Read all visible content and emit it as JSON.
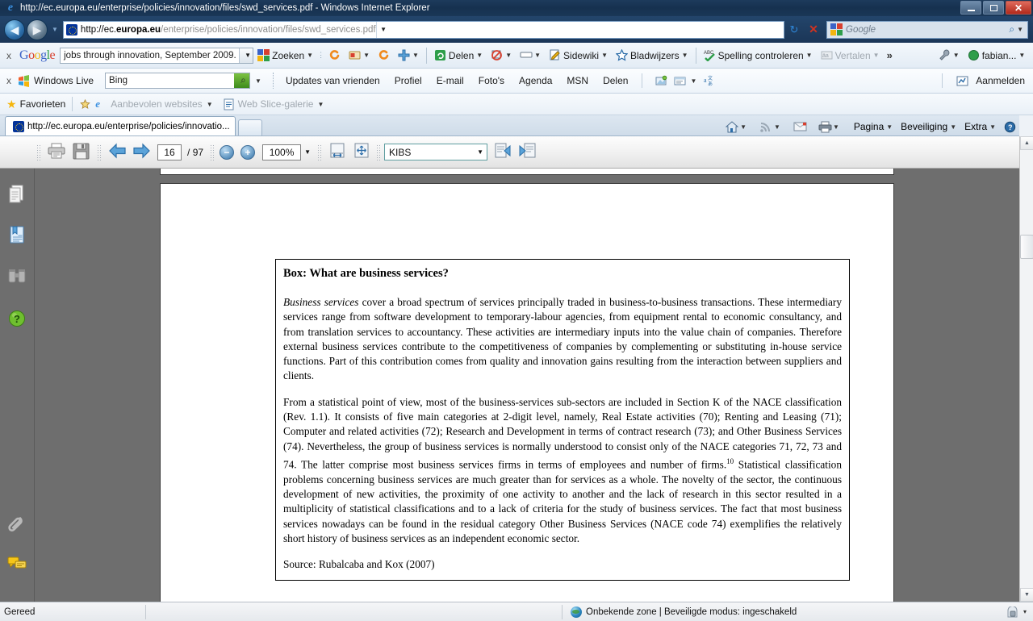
{
  "window": {
    "title": "http://ec.europa.eu/enterprise/policies/innovation/files/swd_services.pdf - Windows Internet Explorer",
    "app_icon": "ie-logo-icon",
    "minimize": "–",
    "maximize": "❐",
    "close": "✕"
  },
  "address_bar": {
    "back_icon": "◀",
    "forward_icon": "▶",
    "history_caret": "▾",
    "site_icon": "eu-flag-icon",
    "url_prefix": "http://ec.",
    "url_domain": "europa.eu",
    "url_path": "/enterprise/policies/innovation/files/swd_services.pdf",
    "dropdown_caret": "▾",
    "refresh_icon": "↻",
    "stop_icon": "✕",
    "search_placeholder": "Google",
    "search_value": "",
    "search_icon": "⚲",
    "search_caret": "▾"
  },
  "google_toolbar": {
    "close_label": "x",
    "logo": [
      {
        "t": "G",
        "c": "b"
      },
      {
        "t": "o",
        "c": "r"
      },
      {
        "t": "o",
        "c": "y"
      },
      {
        "t": "g",
        "c": "b"
      },
      {
        "t": "l",
        "c": "g"
      },
      {
        "t": "e",
        "c": "r"
      }
    ],
    "query": "jobs through innovation, September 2009.",
    "input_caret": "▾",
    "buttons": [
      {
        "label": "Zoeken",
        "icon": "google-multicolor-icon",
        "caret": "▾"
      },
      {
        "label": "",
        "icon": "swirl-icon",
        "caret": ""
      },
      {
        "label": "",
        "icon": "bookmark-card-icon",
        "caret": "▾"
      },
      {
        "label": "",
        "icon": "swirl-icon",
        "caret": ""
      },
      {
        "label": "",
        "icon": "plus-icon",
        "caret": "▾"
      },
      {
        "label": "Delen",
        "icon": "share-icon",
        "caret": "▾"
      },
      {
        "label": "",
        "icon": "popup-blocker-icon",
        "caret": "▾"
      },
      {
        "label": "",
        "icon": "form-fill-icon",
        "caret": "▾"
      },
      {
        "label": "Sidewiki",
        "icon": "sidewiki-icon",
        "caret": "▾"
      },
      {
        "label": "Bladwijzers",
        "icon": "star-icon",
        "caret": "▾"
      },
      {
        "label": "Spelling controleren",
        "icon": "abc-check-icon",
        "caret": "▾"
      },
      {
        "label": "Vertalen",
        "icon": "translate-icon",
        "caret": "▾",
        "disabled": true
      }
    ],
    "overflow": "»",
    "wrench_icon": "wrench-icon",
    "wrench_caret": "▾",
    "account": "fabian...",
    "account_caret": "▾"
  },
  "windows_live_toolbar": {
    "close_label": "x",
    "brand": "Windows Live",
    "search_value": "Bing",
    "search_button_icon": "⚲",
    "search_caret": "▾",
    "links": [
      "Updates van vrienden",
      "Profiel",
      "E-mail",
      "Foto's",
      "Agenda",
      "MSN",
      "Delen"
    ],
    "tool_icons": [
      "map-pin-icon",
      "toolbar-window-icon",
      "translate-a-icon"
    ],
    "right_icon": "signin-icon",
    "right_label": "Aanmelden"
  },
  "favorites_bar": {
    "star_icon": "★",
    "favorites_label": "Favorieten",
    "suggested_icon": "suggested-sites-icon",
    "suggested_label": "Aanbevolen websites",
    "suggested_caret": "▾",
    "webslice_icon": "web-slice-icon",
    "webslice_label": "Web Slice-galerie",
    "webslice_caret": "▾"
  },
  "tab_bar": {
    "tab_icon": "eu-flag-icon",
    "tab_title": "http://ec.europa.eu/enterprise/policies/innovatio...",
    "new_tab_label": "",
    "right_items": [
      {
        "icon": "home-icon",
        "label": "",
        "caret": "▾"
      },
      {
        "icon": "feeds-icon",
        "label": "",
        "caret": "▾"
      },
      {
        "icon": "mail-icon",
        "label": "",
        "caret": ""
      },
      {
        "icon": "print-icon",
        "label": "",
        "caret": "▾"
      },
      {
        "icon": "",
        "label": "Pagina",
        "caret": "▾"
      },
      {
        "icon": "",
        "label": "Beveiliging",
        "caret": "▾"
      },
      {
        "icon": "",
        "label": "Extra",
        "caret": "▾"
      },
      {
        "icon": "help-icon",
        "label": "",
        "caret": "▾"
      }
    ]
  },
  "pdf_toolbar": {
    "print_icon": "print-icon",
    "save_icon": "save-icon",
    "prev_page_icon": "◀",
    "next_page_icon": "▶",
    "current_page": "16",
    "page_separator": "/",
    "total_pages": "97",
    "zoom_out_icon": "−",
    "zoom_in_icon": "+",
    "zoom_level": "100%",
    "zoom_caret": "▾",
    "fit_width_icon": "fit-width-icon",
    "fit_page_icon": "fit-page-icon",
    "find_value": "KIBS",
    "find_caret": "▾",
    "find_prev_icon": "find-previous-icon",
    "find_next_icon": "find-next-icon"
  },
  "nav_pane": {
    "items": [
      {
        "name": "pages-icon",
        "glyph": "▤"
      },
      {
        "name": "bookmarks-icon",
        "glyph": "▤"
      },
      {
        "name": "binoculars-search-icon",
        "glyph": "☷"
      },
      {
        "name": "help-question-icon",
        "glyph": "?"
      },
      {
        "name": "attachments-paperclip-icon",
        "glyph": "📎"
      },
      {
        "name": "comments-icon",
        "glyph": "💬"
      }
    ]
  },
  "document": {
    "box_title": "Box: What are business services?",
    "para1_lead": "Business services",
    "para1_rest": " cover a broad spectrum of services principally traded in business-to-business transactions. These intermediary services range from software development to temporary-labour agencies, from equipment rental to economic consultancy, and from translation services to accountancy. These activities are intermediary inputs into the value chain of companies. Therefore external business services contribute to the competitiveness of companies by complementing or substituting in-house service functions. Part of this contribution comes from quality and innovation gains resulting from the interaction between suppliers and clients.",
    "para2_a": "From a statistical point of view, most of the business-services sub-sectors are included in Section K of the NACE classification (Rev. 1.1). It consists of five main categories at 2-digit level, namely, Real Estate activities (70); Renting and Leasing (71); Computer and related activities (72); Research and Development in terms of contract research (73); and Other Business Services (74). Nevertheless, the group of business services is normally understood to consist only of the NACE categories 71, 72, 73 and 74. The latter comprise most business services firms in terms of employees and number of firms.",
    "para2_footnote": "10",
    "para2_b": " Statistical classification problems concerning business services are much greater than for services as a whole. The novelty of the sector, the continuous development of new activities, the proximity of one activity to another and the lack of research in this sector resulted in a multiplicity of statistical classifications and to a lack of criteria for the study of business services. The fact that most business services nowadays can be found in the residual category Other Business Services (NACE code 74) exemplifies the relatively short history of business services as an independent economic sector.",
    "source": "Source: Rubalcaba and Kox (2007)"
  },
  "scrollbar": {
    "up_arrow": "▲",
    "down_arrow": "▼"
  },
  "status_bar": {
    "left_text": "Gereed",
    "zone_icon": "globe-icon",
    "zone_text": "Onbekende zone | Beveiligde modus: ingeschakeld",
    "lock_icon": "protected-mode-lock-icon",
    "zoom_caret": "▾"
  }
}
